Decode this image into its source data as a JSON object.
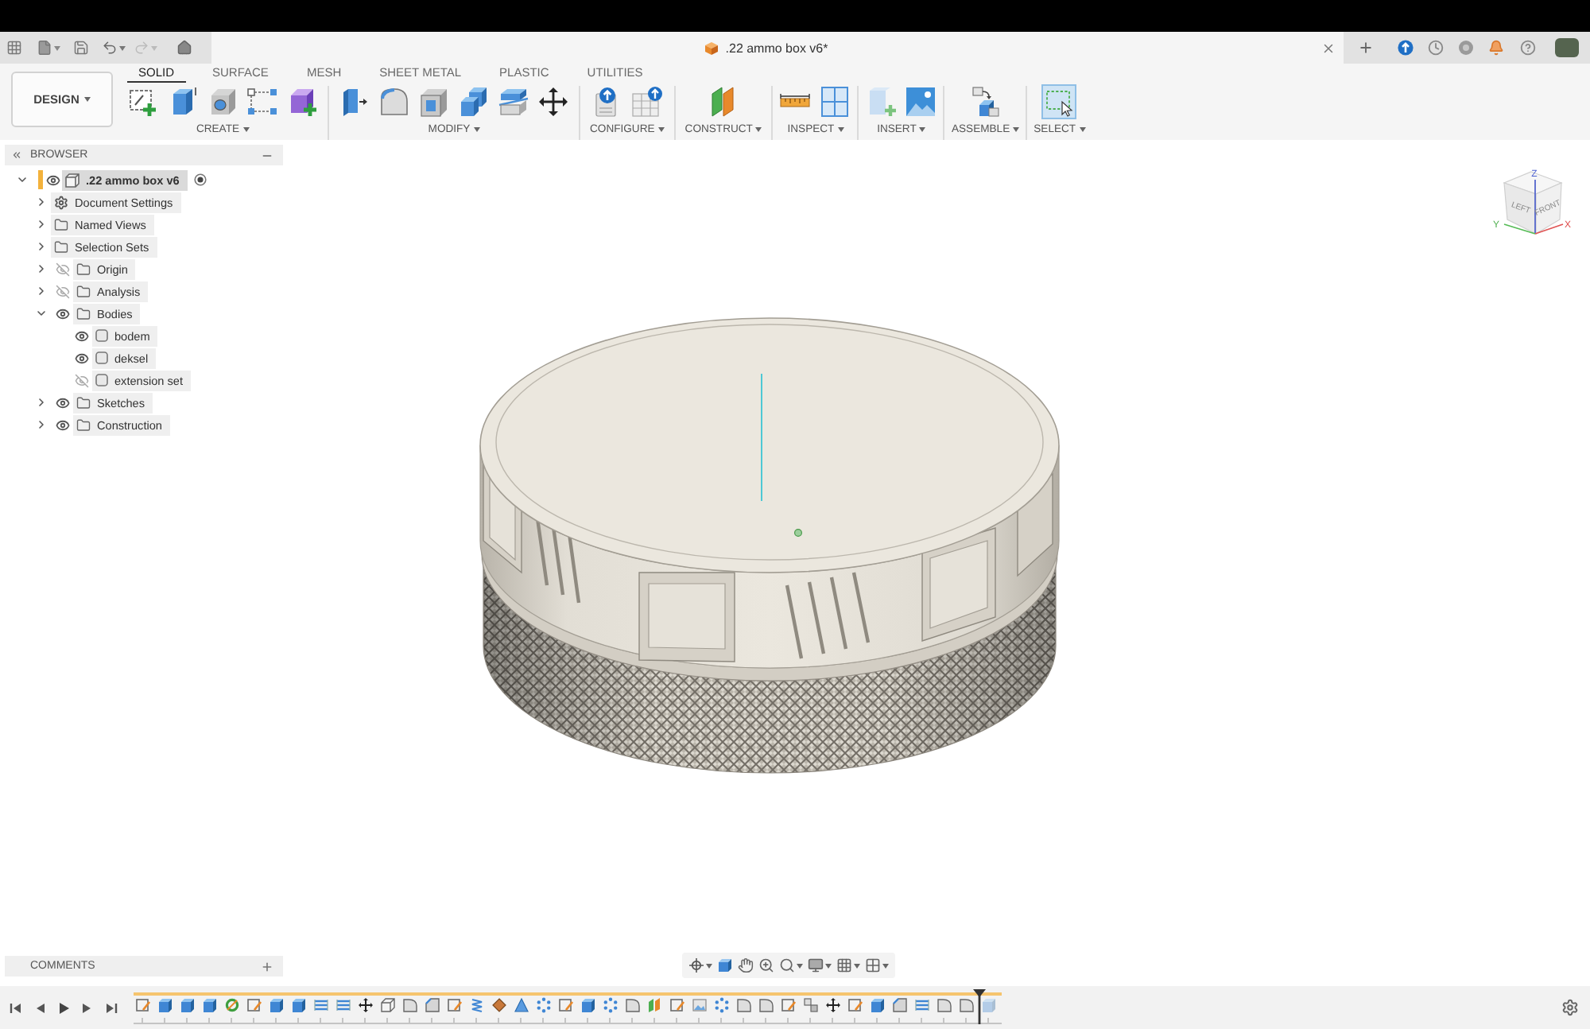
{
  "quick_access": {
    "undo": {
      "disabled": false
    },
    "redo": {
      "disabled": true
    }
  },
  "document_tab": {
    "title": ".22 ammo box v6*"
  },
  "workspace_menu": {
    "label": "DESIGN"
  },
  "toolbar_tabs": [
    {
      "label": "SOLID",
      "selected": true
    },
    {
      "label": "SURFACE",
      "selected": false
    },
    {
      "label": "MESH",
      "selected": false
    },
    {
      "label": "SHEET METAL",
      "selected": false
    },
    {
      "label": "PLASTIC",
      "selected": false
    },
    {
      "label": "UTILITIES",
      "selected": false
    }
  ],
  "tool_groups": [
    {
      "label": "CREATE",
      "kind": "create"
    },
    {
      "label": "MODIFY",
      "kind": "modify"
    },
    {
      "label": "CONFIGURE",
      "kind": "configure"
    },
    {
      "label": "CONSTRUCT",
      "kind": "construct"
    },
    {
      "label": "INSPECT",
      "kind": "inspect"
    },
    {
      "label": "INSERT",
      "kind": "insert"
    },
    {
      "label": "ASSEMBLE",
      "kind": "assemble"
    },
    {
      "label": "SELECT",
      "kind": "select"
    }
  ],
  "browser": {
    "title": "BROWSER",
    "root": {
      "label": ".22 ammo box v6",
      "kind": "component",
      "expanded": true,
      "visible": true,
      "active": true,
      "children": [
        {
          "label": "Document Settings",
          "kind": "settings",
          "expanded": false
        },
        {
          "label": "Named Views",
          "kind": "folder",
          "expanded": false
        },
        {
          "label": "Selection Sets",
          "kind": "folder",
          "expanded": false
        },
        {
          "label": "Origin",
          "kind": "folder",
          "expanded": false,
          "visible": false
        },
        {
          "label": "Analysis",
          "kind": "folder",
          "expanded": false,
          "visible": false
        },
        {
          "label": "Bodies",
          "kind": "folder",
          "expanded": true,
          "visible": true,
          "children": [
            {
              "label": "bodem",
              "kind": "body",
              "visible": true
            },
            {
              "label": "deksel",
              "kind": "body",
              "visible": true
            },
            {
              "label": "extension set",
              "kind": "body",
              "visible": false
            }
          ]
        },
        {
          "label": "Sketches",
          "kind": "folder",
          "expanded": false,
          "visible": true
        },
        {
          "label": "Construction",
          "kind": "folder",
          "expanded": false,
          "visible": true
        }
      ]
    }
  },
  "view_cube": {
    "face_labels": [
      "LEFT",
      "FRONT"
    ],
    "axis_labels": [
      {
        "label": "Z",
        "kind": "z"
      },
      {
        "label": "X",
        "kind": "x"
      },
      {
        "label": "Y",
        "kind": "y"
      }
    ]
  },
  "comments": {
    "title": "COMMENTS"
  },
  "timeline": {
    "level": 0.975
  }
}
